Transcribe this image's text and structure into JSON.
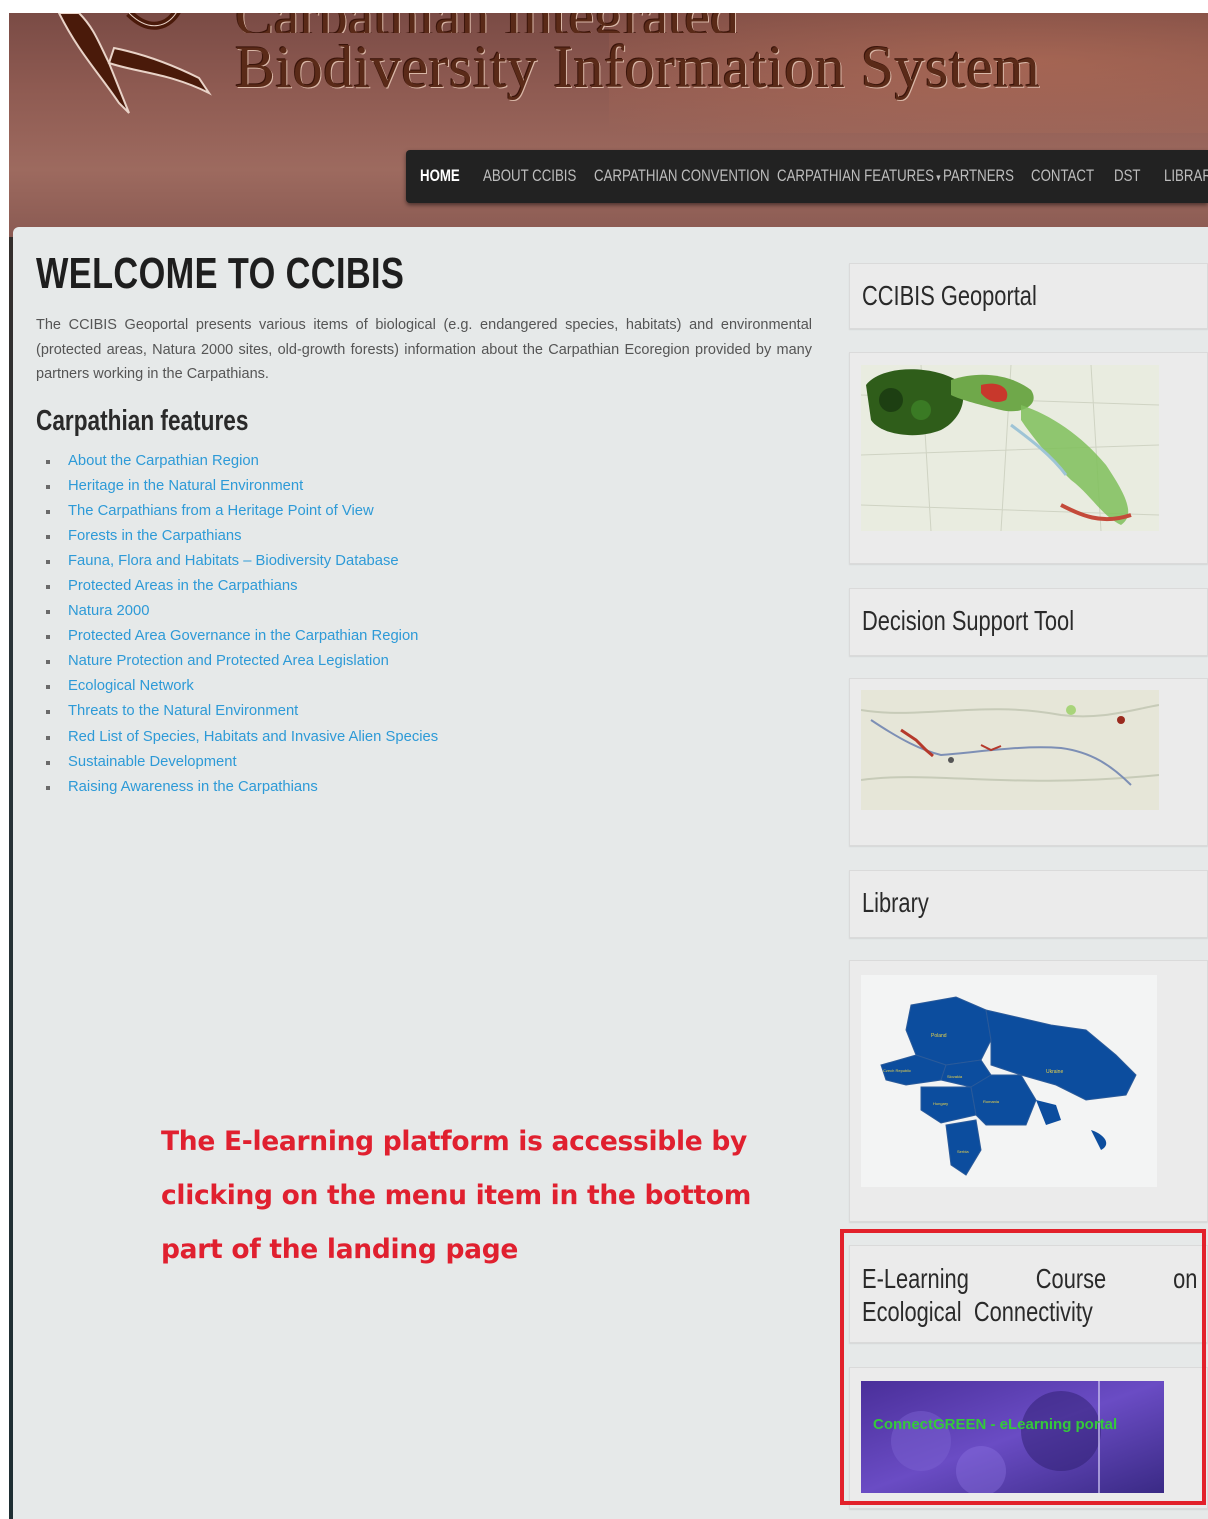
{
  "header": {
    "title_line1": "Carpathian Integrated",
    "title_line2": "Biodiversity Information System"
  },
  "nav": {
    "items": [
      {
        "label": "Home",
        "active": true
      },
      {
        "label": "About CCIBIS"
      },
      {
        "label": "Carpathian Convention"
      },
      {
        "label": "Carpathian Features",
        "has_dropdown": true
      },
      {
        "label": "Partners"
      },
      {
        "label": "Contact"
      },
      {
        "label": "DST"
      },
      {
        "label": "Librar"
      }
    ],
    "dropdown_caret": "▾"
  },
  "main": {
    "title": "WELCOME TO CCIBIS",
    "intro": "The CCIBIS Geoportal presents various items of biological (e.g. endangered species, habitats) and environmental (protected areas, Natura 2000 sites, old-growth forests) information about the Carpathian Ecoregion provided by many partners working in the Carpathians.",
    "features_title": "Carpathian features",
    "features": [
      "About the Carpathian Region",
      "Heritage in the Natural Environment",
      "The Carpathians from a Heritage Point of View",
      "Forests in the Carpathians",
      "Fauna, Flora and Habitats – Biodiversity Database",
      "Protected Areas in the Carpathians",
      "Natura 2000",
      "Protected Area Governance in the Carpathian Region",
      "Nature Protection and Protected Area Legislation",
      "Ecological Network",
      "Threats to the Natural Environment",
      "Red List of Species, Habitats and Invasive Alien Species",
      "Sustainable Development",
      "Raising Awareness in the Carpathians"
    ]
  },
  "sidebar": {
    "geoportal_title": "CCIBIS Geoportal",
    "dst_title": "Decision Support Tool",
    "library_title": "Library",
    "library_map_labels": [
      "Poland",
      "Czech Republic",
      "Slovakia",
      "Ukraine",
      "Hungary",
      "Romania",
      "Serbia"
    ],
    "elearning_title": "E-Learning Course on Ecological Connectivity",
    "elearning_banner": "ConnectGREEN - eLearning portal"
  },
  "annotation": {
    "note": "The E-learning platform is accessible by clicking on the menu item in the bottom part of the landing page"
  },
  "colors": {
    "link": "#2d9ad7",
    "annotation_red": "#e0202f",
    "navbar": "#222222",
    "content_bg": "#e6e9e9"
  }
}
